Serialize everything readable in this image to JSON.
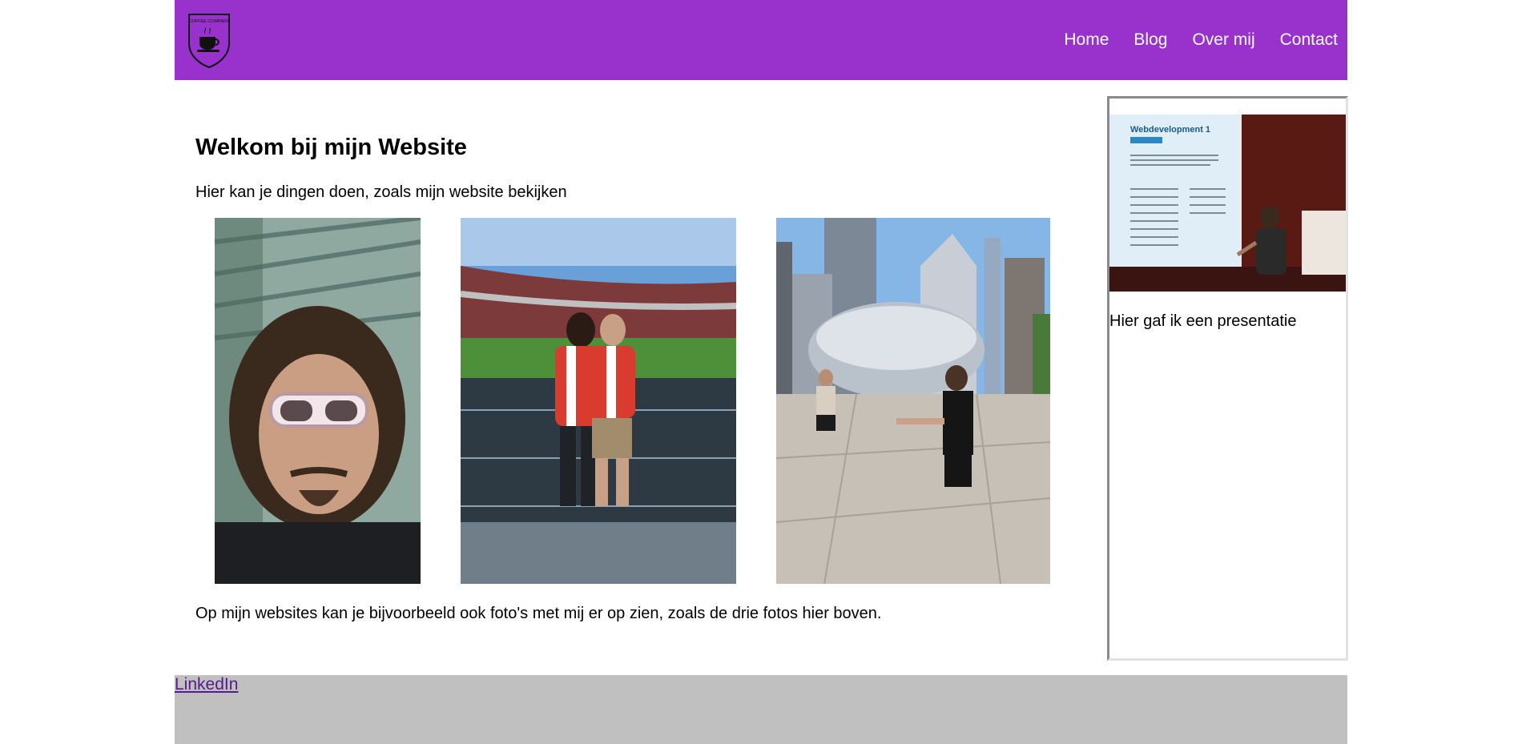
{
  "header": {
    "logo_text": "COFFEE COMPANY",
    "brand_color": "#9932cc",
    "nav": [
      {
        "label": "Home"
      },
      {
        "label": "Blog"
      },
      {
        "label": "Over mij"
      },
      {
        "label": "Contact"
      }
    ]
  },
  "main": {
    "title": "Welkom bij mijn Website",
    "intro": "Hier kan je dingen doen, zoals mijn website bekijken",
    "photos": [
      {
        "icon": "selfie-photo"
      },
      {
        "icon": "stadium-photo"
      },
      {
        "icon": "city-bean-photo"
      }
    ],
    "outro": "Op mijn websites kan je bijvoorbeeld ook foto's met mij er op zien, zoals de drie fotos hier boven."
  },
  "aside": {
    "photo_slide_title": "Webdevelopment 1",
    "caption": "Hier gaf ik een presentatie"
  },
  "footer": {
    "link": "LinkedIn",
    "background": "#c0c0c0"
  }
}
